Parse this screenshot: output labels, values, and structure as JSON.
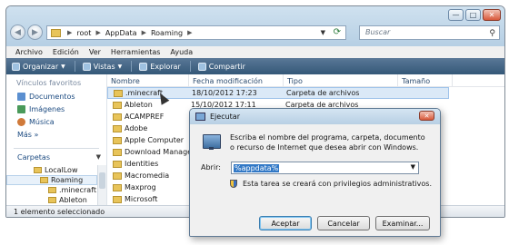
{
  "window": {
    "controls": {
      "minimize": "—",
      "maximize": "□",
      "close": "✕"
    },
    "nav": {
      "back": "◀",
      "forward": "▶"
    },
    "address": {
      "segments": [
        "root",
        "AppData",
        "Roaming"
      ],
      "separator": "▶"
    },
    "search_placeholder": "Buscar"
  },
  "menubar": [
    "Archivo",
    "Edición",
    "Ver",
    "Herramientas",
    "Ayuda"
  ],
  "toolbar": {
    "organize": "Organizar",
    "views": "Vistas",
    "explore": "Explorar",
    "share": "Compartir"
  },
  "sidebar": {
    "favorites_header": "Vínculos favoritos",
    "favorites": [
      {
        "label": "Documentos",
        "color": "#5b8fd0"
      },
      {
        "label": "Imágenes",
        "color": "#4a9a5a"
      },
      {
        "label": "Música",
        "color": "#d07a3a"
      }
    ],
    "more": "Más »",
    "folders_label": "Carpetas",
    "tree": [
      {
        "label": "LocalLow",
        "indent": 2
      },
      {
        "label": "Roaming",
        "indent": 3,
        "selected": true
      },
      {
        "label": ".minecraft",
        "indent": 4
      },
      {
        "label": "Ableton",
        "indent": 4
      }
    ]
  },
  "list": {
    "columns": [
      "Nombre",
      "Fecha modificación",
      "Tipo",
      "Tamaño"
    ],
    "rows": [
      {
        "name": ".minecraft",
        "date": "18/10/2012 17:23",
        "type": "Carpeta de archivos",
        "selected": true
      },
      {
        "name": "Ableton",
        "date": "15/10/2012 17:11",
        "type": "Carpeta de archivos"
      },
      {
        "name": "ACAMPREF",
        "date": "",
        "type": ""
      },
      {
        "name": "Adobe",
        "date": "",
        "type": ""
      },
      {
        "name": "Apple Computer",
        "date": "",
        "type": ""
      },
      {
        "name": "Download Manager",
        "date": "",
        "type": ""
      },
      {
        "name": "Identities",
        "date": "",
        "type": ""
      },
      {
        "name": "Macromedia",
        "date": "",
        "type": ""
      },
      {
        "name": "Maxprog",
        "date": "",
        "type": ""
      },
      {
        "name": "Microsoft",
        "date": "",
        "type": ""
      }
    ]
  },
  "status": "1 elemento seleccionado",
  "dialog": {
    "title": "Ejecutar",
    "description": "Escriba el nombre del programa, carpeta, documento o recurso de Internet que desea abrir con Windows.",
    "open_label": "Abrir:",
    "open_value": "%appdata%",
    "admin_note": "Esta tarea se creará con privilegios administrativos.",
    "buttons": {
      "ok": "Aceptar",
      "cancel": "Cancelar",
      "browse": "Examinar..."
    }
  }
}
